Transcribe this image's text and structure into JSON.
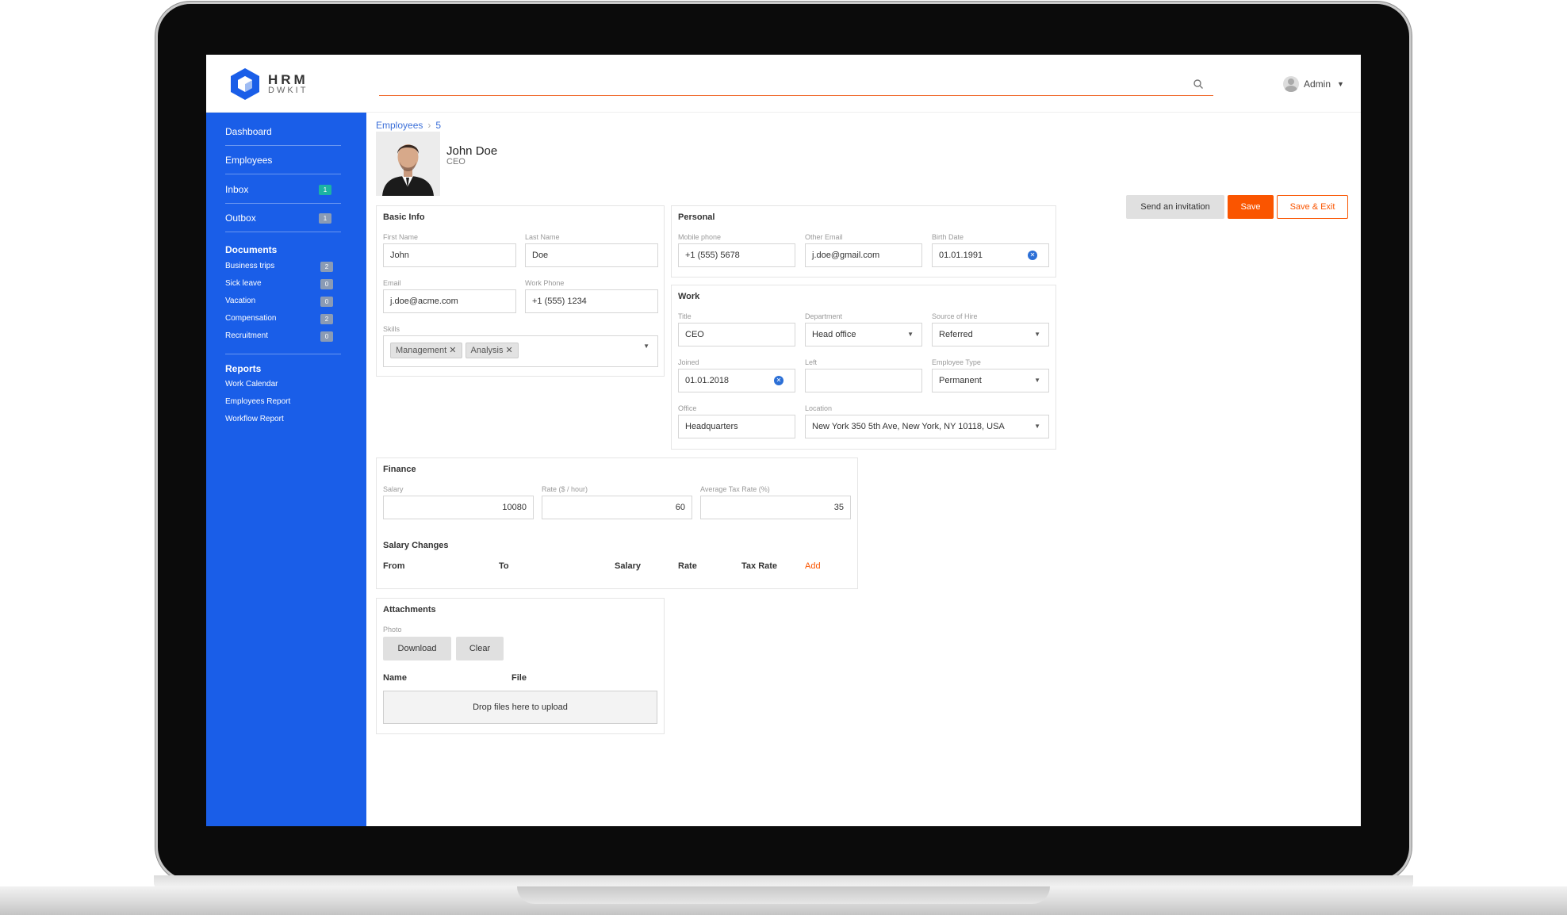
{
  "app": {
    "logo_main": "HRM",
    "logo_sub": "DWKIT",
    "user": "Admin",
    "search": {
      "value": "",
      "placeholder": ""
    }
  },
  "colors": {
    "sidebar": "#1a5ee8",
    "accent": "#fa5500",
    "badge_teal": "#1cb3a3"
  },
  "sidebar": {
    "items": [
      {
        "label": "Dashboard",
        "badge": ""
      },
      {
        "label": "Employees",
        "badge": ""
      },
      {
        "label": "Inbox",
        "badge": "1"
      },
      {
        "label": "Outbox",
        "badge": "1"
      }
    ],
    "documents_title": "Documents",
    "documents": [
      {
        "label": "Business trips",
        "badge": "2"
      },
      {
        "label": "Sick leave",
        "badge": "0"
      },
      {
        "label": "Vacation",
        "badge": "0"
      },
      {
        "label": "Compensation",
        "badge": "2"
      },
      {
        "label": "Recruitment",
        "badge": "0"
      }
    ],
    "reports_title": "Reports",
    "reports": [
      "Work Calendar",
      "Employees Report",
      "Workflow Report"
    ]
  },
  "breadcrumb": {
    "parent": "Employees",
    "current": "5"
  },
  "profile": {
    "name": "John Doe",
    "role": "CEO"
  },
  "actions": {
    "invite": "Send an invitation",
    "save": "Save",
    "save_exit": "Save & Exit"
  },
  "basic_info": {
    "title": "Basic Info",
    "first_name_label": "First Name",
    "first_name": "John",
    "last_name_label": "Last Name",
    "last_name": "Doe",
    "email_label": "Email",
    "email": "j.doe@acme.com",
    "work_phone_label": "Work Phone",
    "work_phone": "+1 (555) 1234",
    "skills_label": "Skills",
    "skills": [
      "Management",
      "Analysis"
    ]
  },
  "personal": {
    "title": "Personal",
    "mobile_label": "Mobile phone",
    "mobile": "+1 (555) 5678",
    "other_email_label": "Other Email",
    "other_email": "j.doe@gmail.com",
    "birth_label": "Birth Date",
    "birth": "01.01.1991"
  },
  "work": {
    "title": "Work",
    "title_label": "Title",
    "title_value": "CEO",
    "department_label": "Department",
    "department": "Head office",
    "source_label": "Source of Hire",
    "source": "Referred",
    "joined_label": "Joined",
    "joined": "01.01.2018",
    "left_label": "Left",
    "left": "",
    "type_label": "Employee Type",
    "type": "Permanent",
    "office_label": "Office",
    "office": "Headquarters",
    "location_label": "Location",
    "location": "New York 350 5th Ave, New York, NY 10118, USA"
  },
  "finance": {
    "title": "Finance",
    "salary_label": "Salary",
    "salary": "10080",
    "rate_label": "Rate ($ / hour)",
    "rate": "60",
    "tax_label": "Average Tax Rate (%)",
    "tax": "35",
    "changes_title": "Salary Changes",
    "columns": [
      "From",
      "To",
      "Salary",
      "Rate",
      "Tax Rate"
    ],
    "add": "Add"
  },
  "attachments": {
    "title": "Attachments",
    "photo_label": "Photo",
    "download": "Download",
    "clear": "Clear",
    "columns": [
      "Name",
      "File"
    ],
    "drop": "Drop files here to upload"
  }
}
